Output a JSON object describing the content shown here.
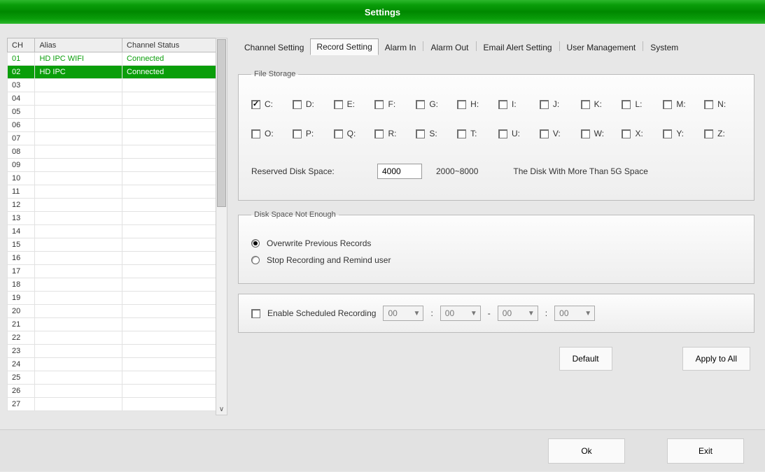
{
  "title": "Settings",
  "tabs": [
    "Channel Setting",
    "Record Setting",
    "Alarm In",
    "Alarm Out",
    "Email Alert Setting",
    "User Management",
    "System"
  ],
  "active_tab": 1,
  "channel_table": {
    "headers": {
      "ch": "CH",
      "alias": "Alias",
      "status": "Channel Status"
    },
    "rows": [
      {
        "ch": "01",
        "alias": "HD IPC WIFI",
        "status": "Connected",
        "state": "connected"
      },
      {
        "ch": "02",
        "alias": "HD IPC",
        "status": "Connected",
        "state": "selected"
      },
      {
        "ch": "03",
        "alias": "",
        "status": ""
      },
      {
        "ch": "04",
        "alias": "",
        "status": ""
      },
      {
        "ch": "05",
        "alias": "",
        "status": ""
      },
      {
        "ch": "06",
        "alias": "",
        "status": ""
      },
      {
        "ch": "07",
        "alias": "",
        "status": ""
      },
      {
        "ch": "08",
        "alias": "",
        "status": ""
      },
      {
        "ch": "09",
        "alias": "",
        "status": ""
      },
      {
        "ch": "10",
        "alias": "",
        "status": ""
      },
      {
        "ch": "11",
        "alias": "",
        "status": ""
      },
      {
        "ch": "12",
        "alias": "",
        "status": ""
      },
      {
        "ch": "13",
        "alias": "",
        "status": ""
      },
      {
        "ch": "14",
        "alias": "",
        "status": ""
      },
      {
        "ch": "15",
        "alias": "",
        "status": ""
      },
      {
        "ch": "16",
        "alias": "",
        "status": ""
      },
      {
        "ch": "17",
        "alias": "",
        "status": ""
      },
      {
        "ch": "18",
        "alias": "",
        "status": ""
      },
      {
        "ch": "19",
        "alias": "",
        "status": ""
      },
      {
        "ch": "20",
        "alias": "",
        "status": ""
      },
      {
        "ch": "21",
        "alias": "",
        "status": ""
      },
      {
        "ch": "22",
        "alias": "",
        "status": ""
      },
      {
        "ch": "23",
        "alias": "",
        "status": ""
      },
      {
        "ch": "24",
        "alias": "",
        "status": ""
      },
      {
        "ch": "25",
        "alias": "",
        "status": ""
      },
      {
        "ch": "26",
        "alias": "",
        "status": ""
      },
      {
        "ch": "27",
        "alias": "",
        "status": ""
      }
    ]
  },
  "file_storage": {
    "legend": "File Storage",
    "drives": [
      {
        "label": "C:",
        "checked": true
      },
      {
        "label": "D:",
        "checked": false
      },
      {
        "label": "E:",
        "checked": false
      },
      {
        "label": "F:",
        "checked": false
      },
      {
        "label": "G:",
        "checked": false
      },
      {
        "label": "H:",
        "checked": false
      },
      {
        "label": "I:",
        "checked": false
      },
      {
        "label": "J:",
        "checked": false
      },
      {
        "label": "K:",
        "checked": false
      },
      {
        "label": "L:",
        "checked": false
      },
      {
        "label": "M:",
        "checked": false
      },
      {
        "label": "N:",
        "checked": false
      },
      {
        "label": "O:",
        "checked": false
      },
      {
        "label": "P:",
        "checked": false
      },
      {
        "label": "Q:",
        "checked": false
      },
      {
        "label": "R:",
        "checked": false
      },
      {
        "label": "S:",
        "checked": false
      },
      {
        "label": "T:",
        "checked": false
      },
      {
        "label": "U:",
        "checked": false
      },
      {
        "label": "V:",
        "checked": false
      },
      {
        "label": "W:",
        "checked": false
      },
      {
        "label": "X:",
        "checked": false
      },
      {
        "label": "Y:",
        "checked": false
      },
      {
        "label": "Z:",
        "checked": false
      }
    ],
    "reserved_label": "Reserved Disk Space:",
    "reserved_value": "4000",
    "reserved_range": "2000~8000",
    "disk_hint": "The Disk With More Than 5G Space"
  },
  "disk_not_enough": {
    "legend": "Disk Space Not Enough",
    "opt_overwrite": "Overwrite Previous Records",
    "opt_stop": "Stop Recording and Remind user",
    "selected": "overwrite"
  },
  "schedule": {
    "enable_label": "Enable Scheduled Recording",
    "enabled": false,
    "h1": "00",
    "m1": "00",
    "h2": "00",
    "m2": "00",
    "sep_colon": ":",
    "sep_dash": "-"
  },
  "buttons": {
    "default": "Default",
    "apply_all": "Apply to All",
    "ok": "Ok",
    "exit": "Exit"
  }
}
